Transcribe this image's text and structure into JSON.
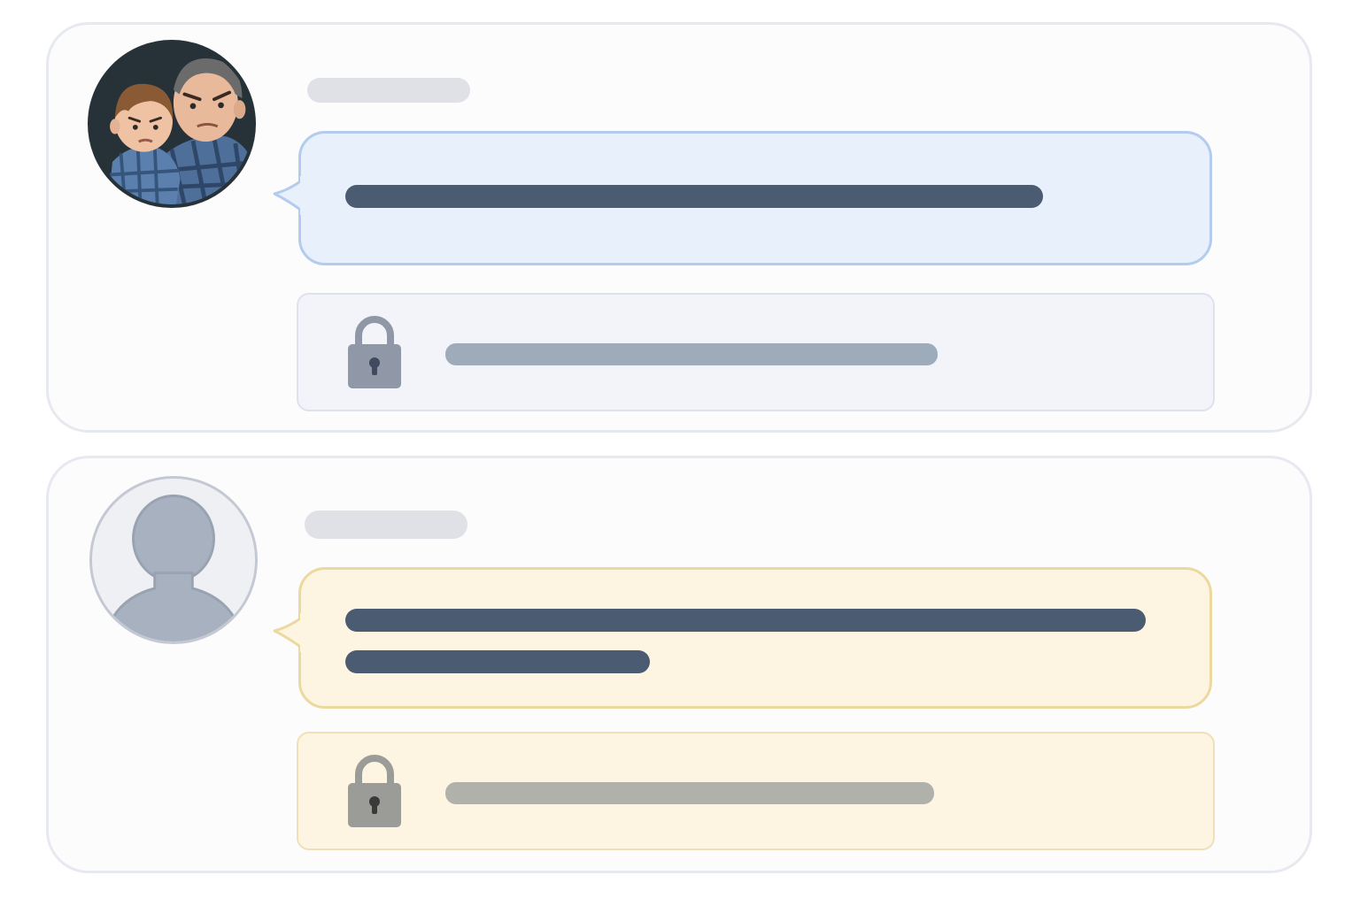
{
  "messages": [
    {
      "sender_avatar": "avatar-photo-man-and-toddler",
      "sender_name": "",
      "message_text_lines": [
        "",
        ""
      ],
      "locked_icon": "lock-icon",
      "locked_text": "",
      "colors": {
        "bubble": "#e8f0fc",
        "bubble_border": "#b3ccee",
        "locked_panel": "#f3f4f9"
      }
    },
    {
      "sender_avatar": "default-user-silhouette-icon",
      "sender_name": "",
      "message_text_lines": [
        "",
        ""
      ],
      "locked_icon": "lock-icon",
      "locked_text": "",
      "colors": {
        "bubble": "#fdf5e2",
        "bubble_border": "#ecd9a0",
        "locked_panel": "#fdf5e2"
      }
    }
  ]
}
